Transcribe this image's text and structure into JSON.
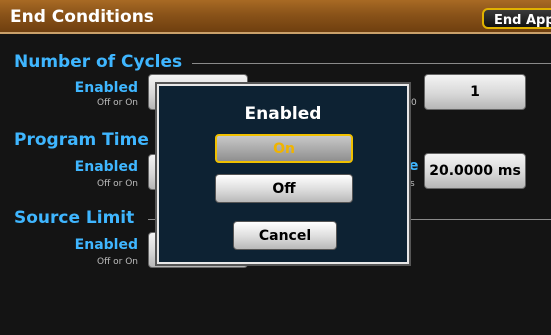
{
  "header": {
    "title": "End Conditions",
    "end_app_label": "End App"
  },
  "sections": [
    {
      "title": "Number of Cycles",
      "enabled_label": "Enabled",
      "enabled_sub": "Off or On",
      "right_label_partial": "",
      "right_sub_partial": "0",
      "right_value": "1"
    },
    {
      "title": "Program Time",
      "enabled_label": "Enabled",
      "enabled_sub": "Off or On",
      "right_label_partial": "e",
      "right_sub_partial": "s",
      "right_value": "20.0000 ms"
    },
    {
      "title": "Source Limit",
      "enabled_label": "Enabled",
      "enabled_sub": "Off or On"
    }
  ],
  "modal": {
    "title": "Enabled",
    "options": [
      "On",
      "Off"
    ],
    "selected": "On",
    "cancel_label": "Cancel"
  },
  "colors": {
    "header_brown": "#8a5319",
    "accent_blue": "#3fb6ff",
    "highlight_gold": "#f0c000",
    "modal_bg": "#0d2233"
  }
}
